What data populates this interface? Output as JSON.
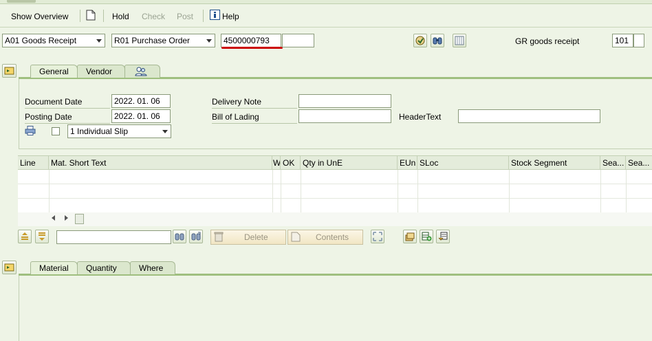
{
  "toolbar": {
    "show_overview": "Show Overview",
    "hold": "Hold",
    "check": "Check",
    "post": "Post",
    "help": "Help"
  },
  "header": {
    "transaction": "A01 Goods Receipt",
    "reference": "R01 Purchase Order",
    "po_number": "4500000793",
    "po_item": "",
    "movement_label": "GR goods receipt",
    "movement_type": "101",
    "movement_extra": ""
  },
  "header_tabs": [
    "General",
    "Vendor"
  ],
  "general": {
    "document_date_label": "Document Date",
    "document_date": "2022. 01. 06",
    "posting_date_label": "Posting Date",
    "posting_date": "2022. 01. 06",
    "delivery_note_label": "Delivery Note",
    "delivery_note": "",
    "bill_of_lading_label": "Bill of Lading",
    "bill_of_lading": "",
    "header_text_label": "HeaderText",
    "header_text": "",
    "slip_option": "1 Individual Slip"
  },
  "items_table": {
    "columns": [
      "Line",
      "Mat. Short Text",
      "W",
      "OK",
      "Qty in UnE",
      "EUn",
      "SLoc",
      "Stock Segment",
      "Sea...",
      "Sea..."
    ],
    "rows": [
      [
        "",
        "",
        "",
        "",
        "",
        "",
        "",
        "",
        "",
        ""
      ],
      [
        "",
        "",
        "",
        "",
        "",
        "",
        "",
        "",
        "",
        ""
      ],
      [
        "",
        "",
        "",
        "",
        "",
        "",
        "",
        "",
        "",
        ""
      ]
    ]
  },
  "table_actions": {
    "search_value": "",
    "delete_label": "Delete",
    "contents_label": "Contents"
  },
  "detail_tabs": [
    "Material",
    "Quantity",
    "Where"
  ],
  "colors": {
    "background": "#eef4e6",
    "tab_accent": "#9fbf7f",
    "highlight_underline": "#cc0000"
  }
}
